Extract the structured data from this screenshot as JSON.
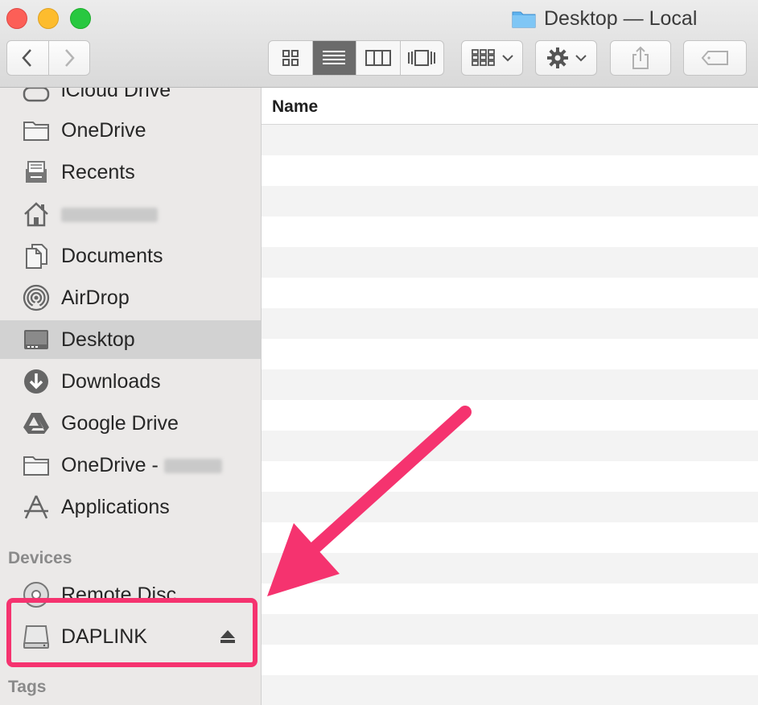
{
  "window": {
    "title": "Desktop — Local",
    "traffic_lights": [
      "close",
      "minimize",
      "zoom"
    ]
  },
  "toolbar": {
    "back_icon": "chevron-left-icon",
    "forward_icon": "chevron-right-icon",
    "view_modes": [
      "icon-view",
      "list-view",
      "column-view",
      "cover-flow-view"
    ],
    "active_view": "list-view",
    "group_icon": "group-by-icon",
    "action_icon": "gear-icon",
    "share_icon": "share-icon",
    "tag_icon": "tag-icon"
  },
  "sidebar": {
    "items": [
      {
        "label": "iCloud Drive",
        "icon": "cloud-icon"
      },
      {
        "label": "OneDrive",
        "icon": "folder-icon"
      },
      {
        "label": "Recents",
        "icon": "recents-icon"
      },
      {
        "label": "",
        "icon": "home-icon"
      },
      {
        "label": "Documents",
        "icon": "documents-icon"
      },
      {
        "label": "AirDrop",
        "icon": "airdrop-icon"
      },
      {
        "label": "Desktop",
        "icon": "desktop-icon"
      },
      {
        "label": "Downloads",
        "icon": "downloads-icon"
      },
      {
        "label": "Google Drive",
        "icon": "google-drive-icon"
      },
      {
        "label": "OneDrive -",
        "icon": "folder-icon"
      },
      {
        "label": "Applications",
        "icon": "applications-icon"
      }
    ],
    "selected": "Desktop",
    "devices_header": "Devices",
    "devices": [
      {
        "label": "Remote Disc",
        "icon": "disc-icon"
      },
      {
        "label": "DAPLINK",
        "icon": "drive-icon",
        "eject_icon": "eject-icon"
      }
    ],
    "tags_header": "Tags"
  },
  "content": {
    "column_header": "Name"
  },
  "colors": {
    "annotation": "#f5336f",
    "selection": "#d2d2d2"
  }
}
